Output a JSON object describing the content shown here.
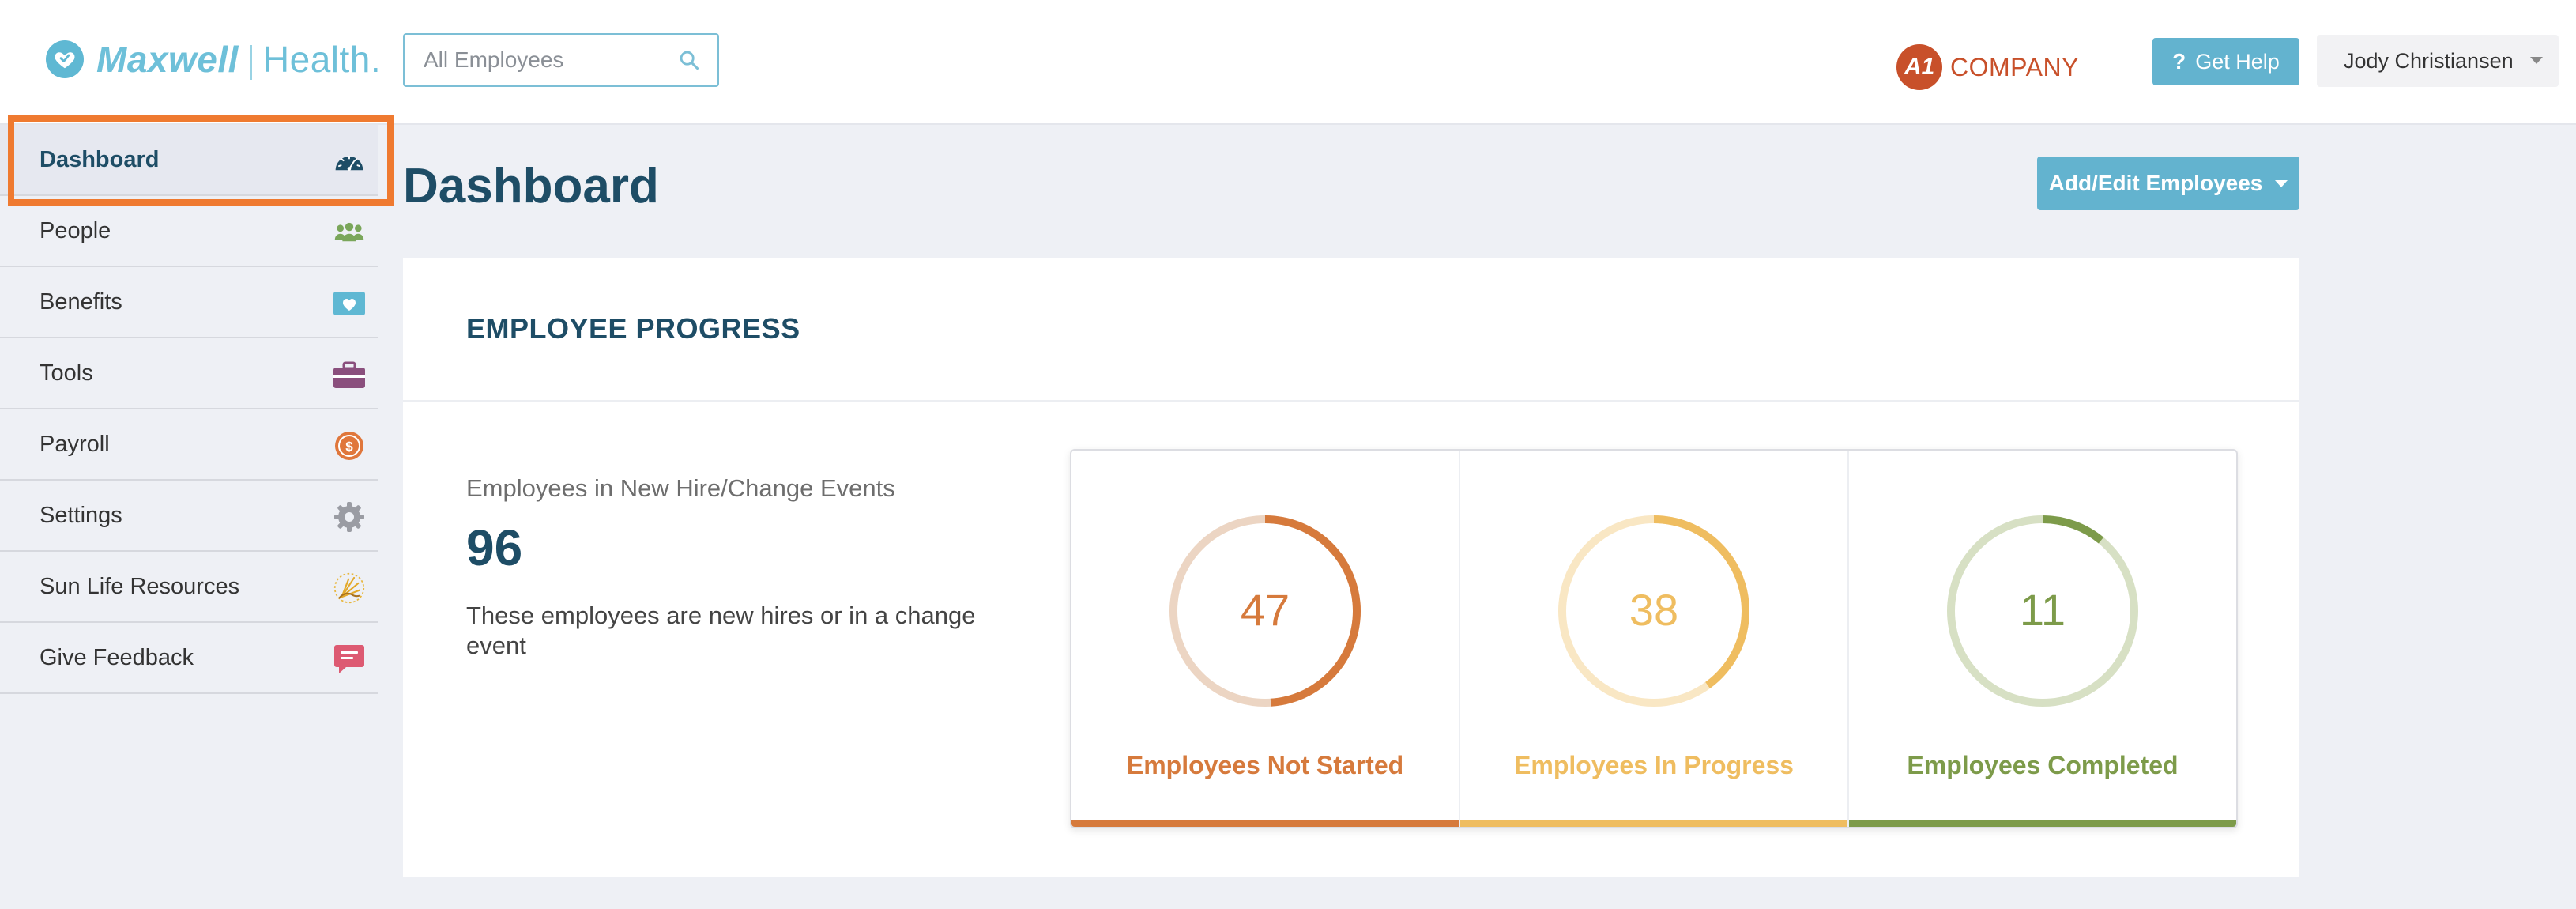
{
  "header": {
    "logo_word_1": "Maxwell",
    "logo_word_2": "Health.",
    "search_placeholder": "All Employees",
    "company_badge": "A1",
    "company_name": "COMPANY",
    "help_label": "Get Help",
    "user_name": "Jody Christiansen"
  },
  "sidebar": {
    "items": [
      {
        "label": "Dashboard",
        "icon": "speedometer-icon",
        "active": true
      },
      {
        "label": "People",
        "icon": "people-icon"
      },
      {
        "label": "Benefits",
        "icon": "heart-card-icon"
      },
      {
        "label": "Tools",
        "icon": "toolbox-icon"
      },
      {
        "label": "Payroll",
        "icon": "dollar-coin-icon"
      },
      {
        "label": "Settings",
        "icon": "gear-icon"
      },
      {
        "label": "Sun Life Resources",
        "icon": "sun-life-icon"
      },
      {
        "label": "Give Feedback",
        "icon": "feedback-icon"
      }
    ]
  },
  "main": {
    "title": "Dashboard",
    "add_edit_label": "Add/Edit Employees",
    "card": {
      "title": "EMPLOYEE PROGRESS",
      "summary_label": "Employees in New Hire/Change Events",
      "summary_count": "96",
      "summary_desc": "These employees are new hires or in a change event",
      "stats": [
        {
          "value": "47",
          "label": "Employees Not Started",
          "fraction": 0.49,
          "color": "#d67a3c",
          "track": "#ecd5c3"
        },
        {
          "value": "38",
          "label": "Employees In Progress",
          "fraction": 0.4,
          "color": "#efbd60",
          "track": "#f9e7c4"
        },
        {
          "value": "11",
          "label": "Employees Completed",
          "fraction": 0.11,
          "color": "#7d9b4a",
          "track": "#d7e0c4"
        }
      ]
    }
  },
  "colors": {
    "brand": "#6ec0d9",
    "primary_button": "#63b3cf",
    "heading": "#1e4d66",
    "highlight": "#ef7a30",
    "company": "#c8502a"
  }
}
